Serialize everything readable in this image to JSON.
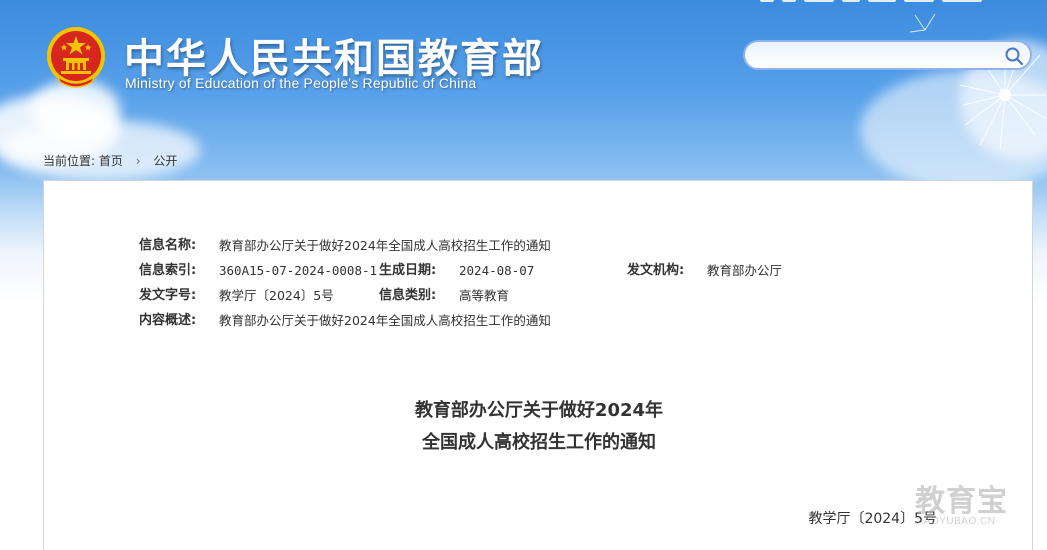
{
  "header": {
    "site_title": "中华人民共和国教育部",
    "site_subtitle": "Ministry of Education of the People's Republic of China",
    "search_placeholder": ""
  },
  "breadcrumb": {
    "prefix": "当前位置:",
    "items": [
      "首页",
      "公开"
    ],
    "separator": "›"
  },
  "meta": {
    "name_label": "信息名称:",
    "name_value": "教育部办公厅关于做好2024年全国成人高校招生工作的通知",
    "index_label": "信息索引:",
    "index_value": "360A15-07-2024-0008-1",
    "date_label": "生成日期:",
    "date_value": "2024-08-07",
    "issuer_label": "发文机构:",
    "issuer_value": "教育部办公厅",
    "docno_label": "发文字号:",
    "docno_value": "教学厅〔2024〕5号",
    "category_label": "信息类别:",
    "category_value": "高等教育",
    "summary_label": "内容概述:",
    "summary_value": "教育部办公厅关于做好2024年全国成人高校招生工作的通知"
  },
  "document": {
    "title_line1": "教育部办公厅关于做好2024年",
    "title_line2": "全国成人高校招生工作的通知",
    "doc_number": "教学厅〔2024〕5号"
  },
  "watermark": {
    "text": "教育宝",
    "domain": "JIAOYUBAO.CN"
  },
  "colors": {
    "sky_top": "#3b8be0",
    "emblem_red": "#d7261e",
    "emblem_gold": "#f4c400",
    "search_border": "#8fb3e8",
    "panel_border": "#cfd6e0"
  }
}
